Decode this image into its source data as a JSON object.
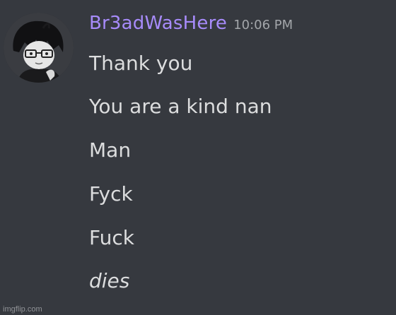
{
  "message": {
    "username": "Br3adWasHere",
    "timestamp": "10:06 PM",
    "avatar_icon": "user-avatar-icon",
    "lines": [
      "Thank you",
      "You are a kind nan",
      "Man",
      "Fyck",
      "Fuck",
      "dies"
    ]
  },
  "watermark": "imgflip.com",
  "colors": {
    "background": "#36393f",
    "username": "#a78bfa",
    "text": "#dcddde",
    "timestamp": "#a3a6aa"
  }
}
